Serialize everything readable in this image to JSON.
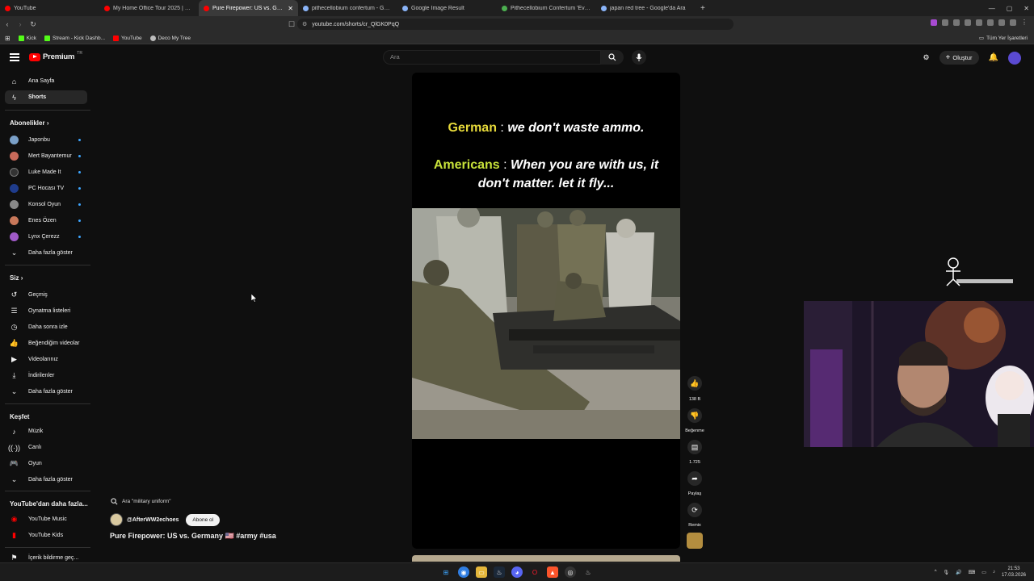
{
  "browser": {
    "tabs": [
      {
        "title": "YouTube",
        "color": "#ff0000",
        "active": false
      },
      {
        "title": "My Home Office Tour 2025 | Content",
        "color": "#ff0000",
        "active": false
      },
      {
        "title": "Pure Firepower: US vs. Germ...",
        "color": "#ff0000",
        "active": true
      },
      {
        "title": "pithecellobium confertum - Google",
        "color": "#8ab4f8",
        "active": false
      },
      {
        "title": "Google Image Result",
        "color": "#8ab4f8",
        "active": false
      },
      {
        "title": "Pithecellobium Confertum 'Everfresh'",
        "color": "#4caf50",
        "active": false
      },
      {
        "title": "japan red tree - Google'da Ara",
        "color": "#8ab4f8",
        "active": false
      }
    ],
    "url": "youtube.com/shorts/cr_QlGK0PqQ",
    "bookmarks": [
      {
        "label": "Kick",
        "color": "#53fc18"
      },
      {
        "label": "Stream - Kick Dashb...",
        "color": "#53fc18"
      },
      {
        "label": "YouTube",
        "color": "#ff0000"
      },
      {
        "label": "Deco My Tree",
        "color": "#bbbbbb"
      }
    ],
    "all_bookmarks": "Tüm Yer İşaretleri"
  },
  "youtube": {
    "logo": "Premium",
    "logo_country": "TR",
    "search_placeholder": "Ara",
    "create_label": "Oluştur"
  },
  "sidebar": {
    "home": "Ana Sayfa",
    "shorts": "Shorts",
    "subs_header": "Abonelikler",
    "subs": [
      {
        "label": "Japonbu",
        "color": "#7aa0c8"
      },
      {
        "label": "Mert Bayantemur",
        "color": "#c86a5a"
      },
      {
        "label": "Luke Made It",
        "color": "#333333"
      },
      {
        "label": "PC Hocası TV",
        "color": "#1f3c8c"
      },
      {
        "label": "Konsol Oyun",
        "color": "#888888"
      },
      {
        "label": "Enes Özen",
        "color": "#c8785a"
      },
      {
        "label": "Lynx Çerezz",
        "color": "#a05ac8"
      }
    ],
    "show_more": "Daha fazla göster",
    "you_header": "Siz",
    "you_items": [
      "Geçmiş",
      "Oynatma listeleri",
      "Daha sonra izle",
      "Beğendiğim videolar",
      "Videolarınız",
      "İndirilenler",
      "Daha fazla göster"
    ],
    "explore_header": "Keşfet",
    "explore_items": [
      "Müzik",
      "Canlı",
      "Oyun",
      "Daha fazla göster"
    ],
    "more_header": "YouTube'dan daha fazla...",
    "more_items": [
      "YouTube Music",
      "YouTube Kids"
    ],
    "settings_cut": "İçerik bildirme geç..."
  },
  "short": {
    "line1_tag": "German",
    "line1_sep": " : ",
    "line1_text": "we don't waste ammo.",
    "line2_tag": "Americans",
    "line2_sep": " : ",
    "line2_text": "When you are with us, it",
    "line3_text": "don't matter. let it fly...",
    "tag_color": "#e6d93a",
    "tag2_color": "#c8e23a"
  },
  "rail": {
    "likes": "138 B",
    "dislike": "Beğenme",
    "comments": "1.725",
    "share": "Paylaş",
    "remix": "Remix"
  },
  "meta": {
    "search_chip": "Ara \"military uniform\"",
    "channel": "@AfterWW2echoes",
    "subscribe": "Abone ol",
    "title": "Pure Firepower: US vs. Germany 🇺🇸 #army #usa"
  },
  "taskbar": {
    "time": "21:53",
    "date": "17.03.2026"
  }
}
